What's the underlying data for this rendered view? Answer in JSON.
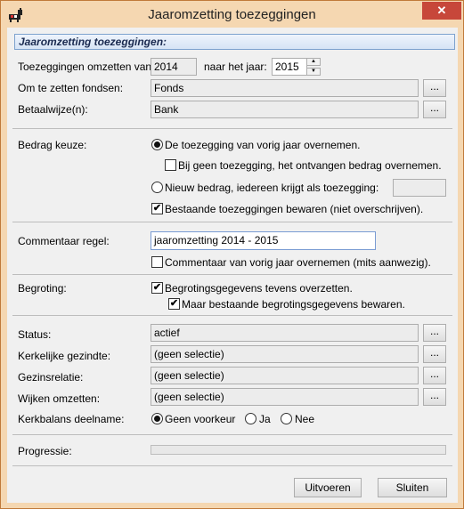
{
  "window": {
    "title": "Jaaromzetting toezeggingen",
    "close_glyph": "✕",
    "icon": "app-animal-icon"
  },
  "header": {
    "title": "Jaaromzetting toezeggingen:"
  },
  "convert": {
    "from_label": "Toezeggingen omzetten van:",
    "from_year": "2014",
    "to_label": "naar het jaar:",
    "to_year": "2015"
  },
  "funds": {
    "label": "Om te zetten fondsen:",
    "value": "Fonds",
    "browse": "..."
  },
  "payment": {
    "label": "Betaalwijze(n):",
    "value": "Bank",
    "browse": "..."
  },
  "amount": {
    "label": "Bedrag keuze:",
    "opt_prev": "De toezegging van vorig jaar overnemen.",
    "opt_prev_selected": true,
    "no_pledge": "Bij geen toezegging, het ontvangen bedrag overnemen.",
    "no_pledge_checked": false,
    "opt_new": "Nieuw bedrag, iedereen krijgt als toezegging:",
    "opt_new_selected": false,
    "new_amount": "",
    "keep_existing": "Bestaande toezeggingen bewaren (niet overschrijven).",
    "keep_existing_checked": true
  },
  "comment": {
    "label": "Commentaar regel:",
    "value": "jaaromzetting 2014 - 2015",
    "copy_prev": "Commentaar van vorig jaar overnemen (mits aanwezig).",
    "copy_prev_checked": false
  },
  "budget": {
    "label": "Begroting:",
    "transfer": "Begrotingsgegevens tevens overzetten.",
    "transfer_checked": true,
    "keep": "Maar bestaande begrotingsgegevens bewaren.",
    "keep_checked": true
  },
  "filters": {
    "status_label": "Status:",
    "status_value": "actief",
    "church_label": "Kerkelijke gezindte:",
    "church_value": "(geen selectie)",
    "family_label": "Gezinsrelatie:",
    "family_value": "(geen selectie)",
    "district_label": "Wijken omzetten:",
    "district_value": "(geen selectie)",
    "browse": "..."
  },
  "participation": {
    "label": "Kerkbalans deelname:",
    "options": [
      "Geen voorkeur",
      "Ja",
      "Nee"
    ],
    "selected_index": 0
  },
  "progress": {
    "label": "Progressie:",
    "value": 0
  },
  "actions": {
    "run": "Uitvoeren",
    "close": "Sluiten"
  },
  "colors": {
    "frame": "#f5d7b1",
    "close": "#c7473a",
    "header_border": "#7da2ce"
  }
}
